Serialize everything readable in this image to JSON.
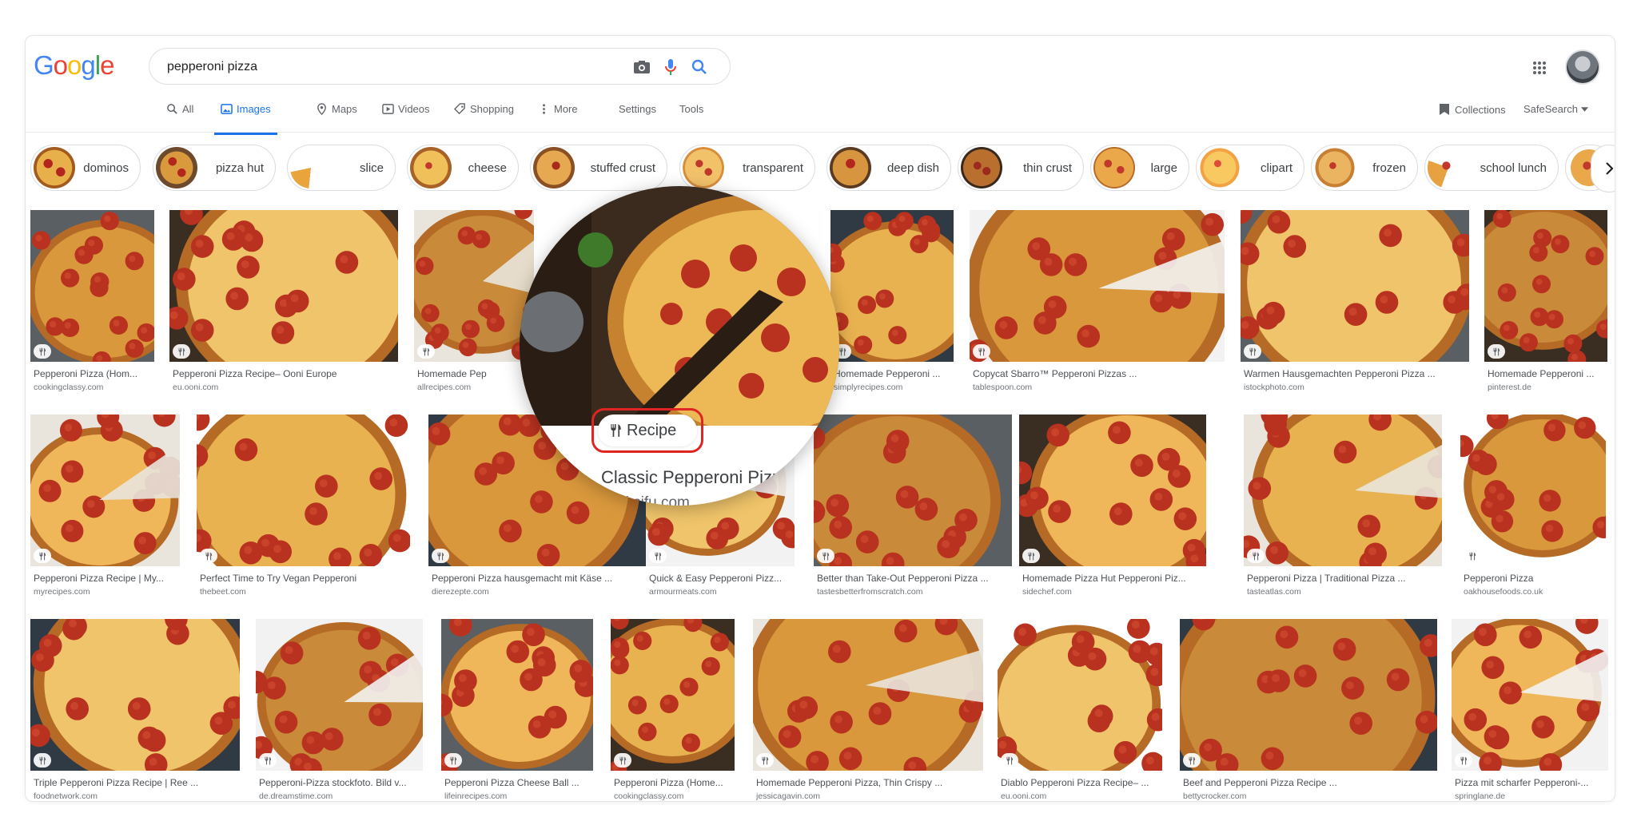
{
  "logo": "Google",
  "search": {
    "query": "pepperoni pizza"
  },
  "tabs": [
    "All",
    "Images",
    "Maps",
    "Videos",
    "Shopping",
    "More"
  ],
  "settings_links": [
    "Settings",
    "Tools"
  ],
  "collections": "Collections",
  "safesearch": "SafeSearch",
  "chips": [
    "dominos",
    "pizza hut",
    "slice",
    "cheese",
    "stuffed crust",
    "transparent",
    "deep dish",
    "thin crust",
    "large",
    "clipart",
    "frozen",
    "school lunch"
  ],
  "row1": [
    {
      "title": "Pepperoni Pizza (Hom...",
      "source": "cookingclassy.com"
    },
    {
      "title": "Pepperoni Pizza Recipe– Ooni Europe",
      "source": "eu.ooni.com"
    },
    {
      "title": "Homemade Pep",
      "source": "allrecipes.com"
    },
    {
      "title": "",
      "source": ""
    },
    {
      "title": "Homemade Pepperoni ...",
      "source": "simplyrecipes.com"
    },
    {
      "title": "Copycat Sbarro™ Pepperoni Pizzas ...",
      "source": "tablespoon.com"
    },
    {
      "title": "Warmen Hausgemachten Pepperoni Pizza ...",
      "source": "istockphoto.com"
    },
    {
      "title": "Homemade Pepperoni ...",
      "source": "pinterest.de"
    }
  ],
  "row2": [
    {
      "title": "Pepperoni Pizza Recipe | My...",
      "source": "myrecipes.com"
    },
    {
      "title": "Perfect Time to Try Vegan Pepperoni",
      "source": "thebeet.com"
    },
    {
      "title": "Pepperoni Pizza hausgemacht mit Käse ...",
      "source": "dierezepte.com"
    },
    {
      "title": "Quick & Easy Pepperoni Pizz...",
      "source": "armourmeats.com"
    },
    {
      "title": "Better than Take-Out Pepperoni Pizza ...",
      "source": "tastesbetterfromscratch.com"
    },
    {
      "title": "Homemade Pizza Hut Pepperoni Piz...",
      "source": "sidechef.com"
    },
    {
      "title": "Pepperoni Pizza | Traditional Pizza ...",
      "source": "tasteatlas.com"
    },
    {
      "title": "Pepperoni Pizza",
      "source": "oakhousefoods.co.uk"
    }
  ],
  "row3": [
    {
      "title": "Triple Pepperoni Pizza Recipe | Ree ...",
      "source": "foodnetwork.com"
    },
    {
      "title": "Pepperoni-Pizza stockfoto. Bild v...",
      "source": "de.dreamstime.com"
    },
    {
      "title": "Pepperoni Pizza Cheese Ball ...",
      "source": "lifeinrecipes.com"
    },
    {
      "title": "Pepperoni Pizza (Home...",
      "source": "cookingclassy.com"
    },
    {
      "title": "Homemade Pepperoni Pizza, Thin Crispy ...",
      "source": "jessicagavin.com"
    },
    {
      "title": "Diablo Pepperoni Pizza Recipe– ...",
      "source": "eu.ooni.com"
    },
    {
      "title": "Beef and Pepperoni Pizza Recipe ...",
      "source": "bettycrocker.com"
    },
    {
      "title": "Pizza mit scharfer Pepperoni-...",
      "source": "springlane.de"
    }
  ],
  "magnifier": {
    "badge": "Recipe",
    "title": "Classic Pepperoni Pizza - C",
    "source": "cooksifu.com"
  },
  "colors": {
    "accent": "#1a73e8",
    "highlight_ring": "#e02424"
  }
}
